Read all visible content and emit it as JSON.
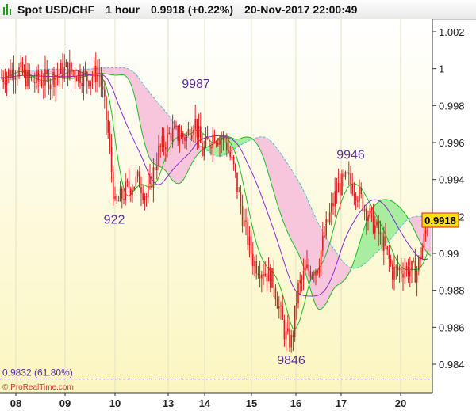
{
  "header": {
    "instrument": "Spot USD/CHF",
    "timeframe": "1 hour",
    "price": "0.9918",
    "change": "(+0.22%)",
    "datetime": "20-Nov-2017 22:00:49"
  },
  "watermark": "© ProRealTime.com",
  "colors": {
    "candle": "#d42020",
    "cloud_bull": "#a8eda0",
    "cloud_bear": "#f8c6dc",
    "kijun": "#8a2bd2",
    "tenkan": "#22bb22",
    "span_a": "#22bb22",
    "span_b": "#e060a0",
    "chart_bg_top": "#ffffff",
    "chart_bg_bottom": "#fbf6c0"
  },
  "chart_data": {
    "type": "candlestick",
    "y_axis": {
      "min": 0.9828,
      "max": 1.0024,
      "ticks": [
        "1.002",
        "1",
        "0.998",
        "0.996",
        "0.994",
        "0.992",
        "0.99",
        "0.988",
        "0.986",
        "0.984"
      ]
    },
    "x_axis": {
      "labels": [
        "08",
        "09",
        "10",
        "13",
        "14",
        "15",
        "16",
        "17",
        "20"
      ]
    },
    "current_price": "0.9918",
    "fib_level": {
      "label": "0.9832 (61.80%)",
      "value": 0.9832
    },
    "annotations": [
      {
        "text": "9987",
        "value": 0.9987
      },
      {
        "text": "922",
        "value": 0.9922
      },
      {
        "text": "9946",
        "value": 0.9946
      },
      {
        "text": "9846",
        "value": 0.9846
      }
    ],
    "price_path": [
      [
        0,
        0.9995
      ],
      [
        20,
        1.0
      ],
      [
        40,
        0.9993
      ],
      [
        60,
        0.9994
      ],
      [
        85,
        1.0
      ],
      [
        110,
        0.9995
      ],
      [
        125,
        0.9998
      ],
      [
        135,
        0.997
      ],
      [
        145,
        0.9925
      ],
      [
        160,
        0.9935
      ],
      [
        175,
        0.994
      ],
      [
        185,
        0.993
      ],
      [
        200,
        0.9955
      ],
      [
        215,
        0.9965
      ],
      [
        235,
        0.9963
      ],
      [
        245,
        0.9973
      ],
      [
        255,
        0.9955
      ],
      [
        270,
        0.9965
      ],
      [
        285,
        0.996
      ],
      [
        295,
        0.9945
      ],
      [
        308,
        0.9915
      ],
      [
        320,
        0.9895
      ],
      [
        335,
        0.989
      ],
      [
        345,
        0.9885
      ],
      [
        352,
        0.987
      ],
      [
        360,
        0.9855
      ],
      [
        368,
        0.9852
      ],
      [
        375,
        0.988
      ],
      [
        385,
        0.989
      ],
      [
        400,
        0.9893
      ],
      [
        412,
        0.9915
      ],
      [
        425,
        0.9935
      ],
      [
        438,
        0.994
      ],
      [
        448,
        0.9935
      ],
      [
        460,
        0.9925
      ],
      [
        472,
        0.9915
      ],
      [
        485,
        0.9903
      ],
      [
        495,
        0.989
      ],
      [
        510,
        0.9892
      ],
      [
        525,
        0.989
      ],
      [
        540,
        0.9918
      ]
    ]
  }
}
